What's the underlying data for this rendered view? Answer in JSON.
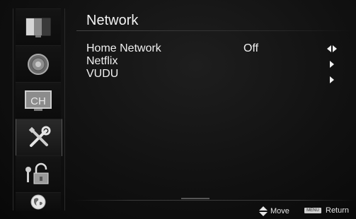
{
  "page": {
    "title": "Network"
  },
  "sidebar": {
    "items": [
      {
        "icon": "picture-icon"
      },
      {
        "icon": "sound-icon"
      },
      {
        "icon": "channel-icon",
        "label": "CH"
      },
      {
        "icon": "tools-icon"
      },
      {
        "icon": "parental-lock-icon"
      },
      {
        "icon": "network-globe-icon"
      }
    ]
  },
  "menu": {
    "items": [
      {
        "label": "Home Network",
        "value": "Off",
        "arrow": "left-right-arrow-icon"
      },
      {
        "label": "Netflix",
        "value": "",
        "arrow": "right-arrow-icon"
      },
      {
        "label": "VUDU",
        "value": "",
        "arrow": "right-arrow-icon"
      }
    ]
  },
  "footer": {
    "move_label": "Move",
    "menu_badge": "MENU",
    "return_label": "Return"
  },
  "colors": {
    "background": "#111111",
    "text": "#f0f0f0",
    "accent_icon": "#c0c0c0"
  }
}
